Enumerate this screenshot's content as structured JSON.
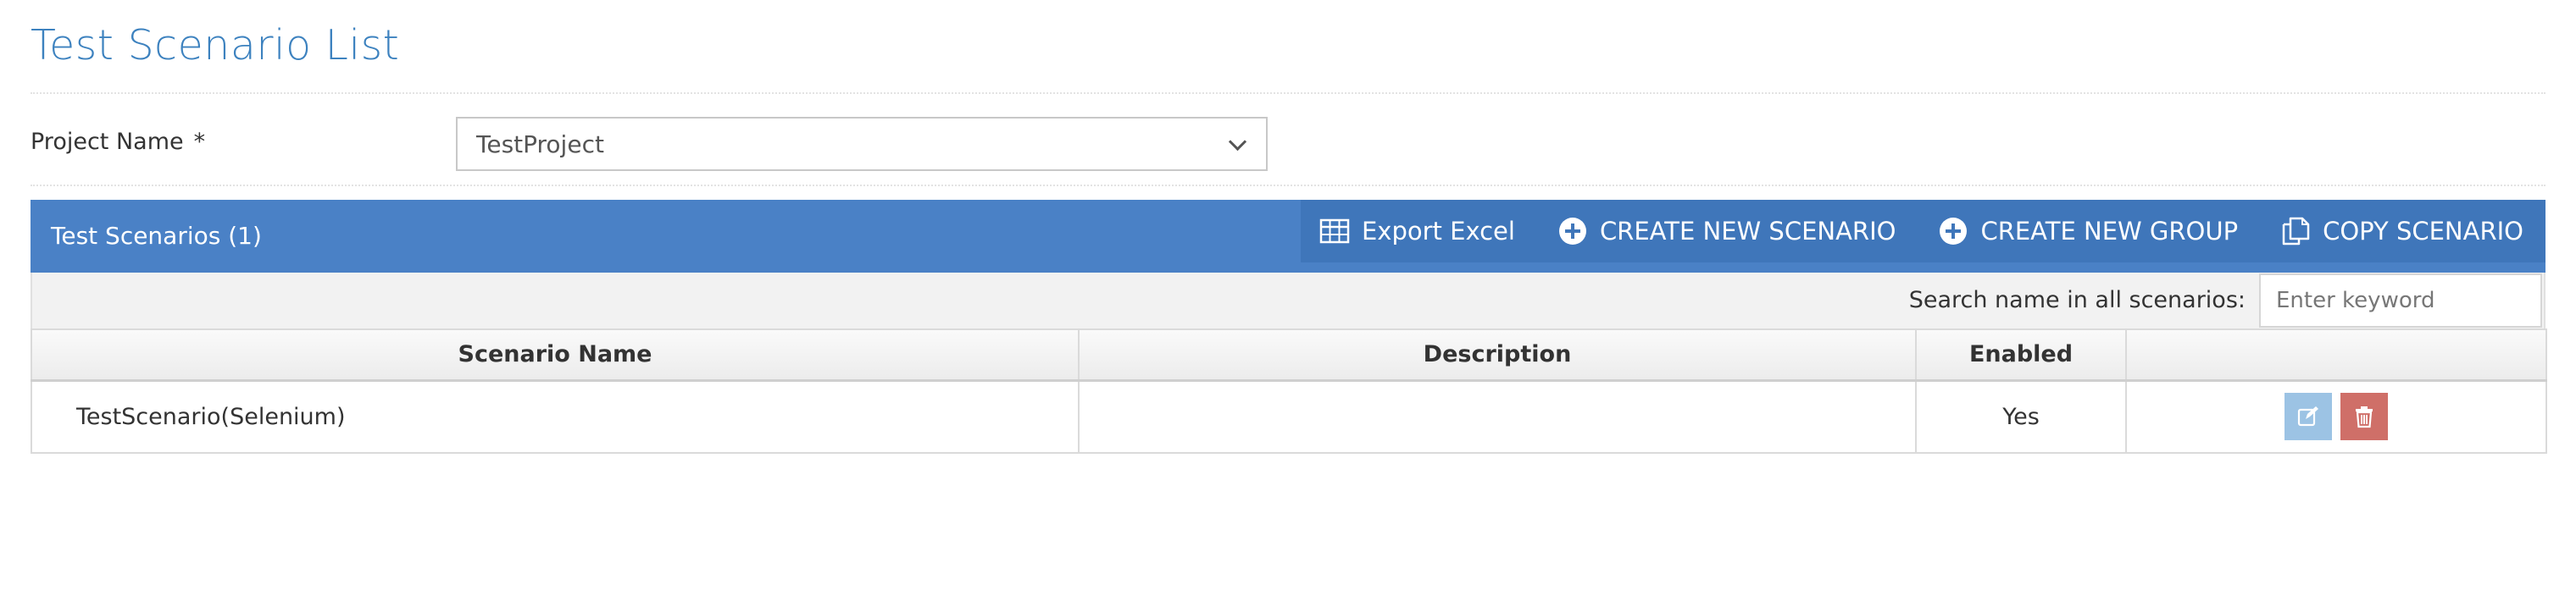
{
  "page": {
    "title": "Test Scenario List"
  },
  "form": {
    "project_label": "Project Name",
    "required_mark": "*",
    "project_value": "TestProject"
  },
  "panel": {
    "title": "Test Scenarios (1)",
    "actions": [
      {
        "label": "Export Excel",
        "icon": "table-icon"
      },
      {
        "label": "CREATE NEW SCENARIO",
        "icon": "plus-circle-icon"
      },
      {
        "label": "CREATE NEW GROUP",
        "icon": "plus-circle-icon"
      },
      {
        "label": "COPY SCENARIO",
        "icon": "copy-icon"
      }
    ]
  },
  "search": {
    "label": "Search name in all scenarios:",
    "placeholder": "Enter keyword",
    "value": ""
  },
  "table": {
    "headers": [
      "Scenario Name",
      "Description",
      "Enabled",
      ""
    ],
    "rows": [
      {
        "name": "TestScenario(Selenium)",
        "description": "",
        "enabled": "Yes"
      }
    ]
  },
  "colors": {
    "title": "#3d82bf",
    "panel_header": "#4a81c6",
    "panel_actions": "#3f76ba",
    "edit_button": "#9cc3e4",
    "delete_button": "#cf6f68"
  }
}
